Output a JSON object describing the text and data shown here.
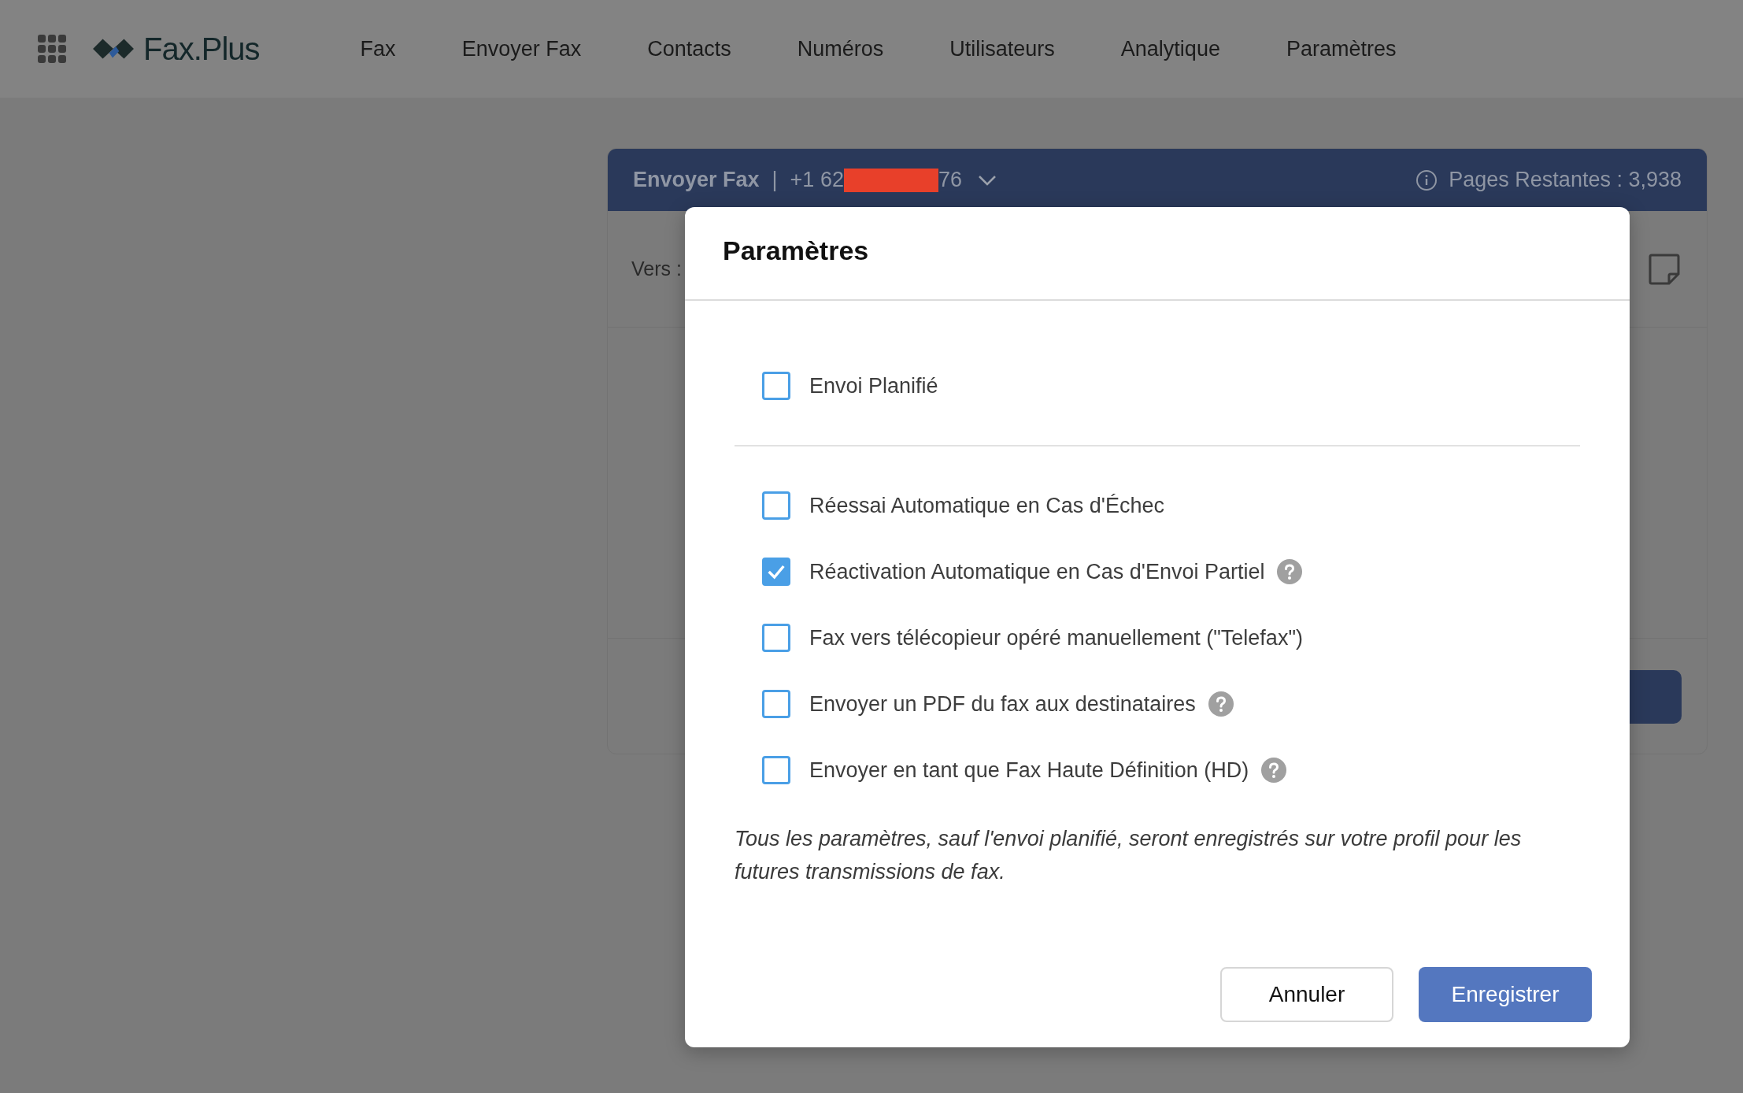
{
  "header": {
    "logo_text": "Fax.Plus",
    "nav": [
      "Fax",
      "Envoyer Fax",
      "Contacts",
      "Numéros",
      "Utilisateurs",
      "Analytique",
      "Paramètres"
    ]
  },
  "send_card": {
    "title": "Envoyer Fax",
    "separator": "|",
    "number_prefix": "+1 62",
    "number_redacted": true,
    "number_suffix": "76",
    "pages_remaining": "Pages Restantes : 3,938",
    "to_label": "Vers :"
  },
  "dialog": {
    "title": "Paramètres",
    "option_groups": [
      [
        {
          "label": "Envoi Planifié",
          "checked": false,
          "help": false
        }
      ],
      [
        {
          "label": "Réessai Automatique en Cas d'Échec",
          "checked": false,
          "help": false
        },
        {
          "label": "Réactivation Automatique en Cas d'Envoi Partiel",
          "checked": true,
          "help": true
        },
        {
          "label": "Fax vers télécopieur opéré manuellement (\"Telefax\")",
          "checked": false,
          "help": false
        },
        {
          "label": "Envoyer un PDF du fax aux destinataires",
          "checked": false,
          "help": true
        },
        {
          "label": "Envoyer en tant que Fax Haute Définition (HD)",
          "checked": false,
          "help": true
        }
      ]
    ],
    "note": "Tous les paramètres, sauf l'envoi planifié, seront enregistrés sur votre profil pour les futures transmissions de fax.",
    "buttons": [
      {
        "label": "Annuler",
        "kind": "secondary"
      },
      {
        "label": "Enregistrer",
        "kind": "primary"
      }
    ]
  }
}
